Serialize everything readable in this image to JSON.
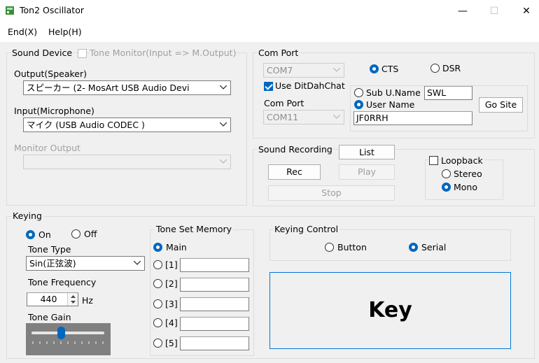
{
  "window": {
    "title": "Ton2 Oscillator",
    "minimize": "—",
    "maximize": "☐",
    "close": "✕"
  },
  "menu": {
    "end": "End(X)",
    "help": "Help(H)"
  },
  "sound_device": {
    "legend": "Sound Device",
    "tone_monitor_label": "Tone Monitor(Input => M.Output)",
    "tone_monitor_checked": false,
    "output_label": "Output(Speaker)",
    "output_value": "スピーカー (2- MosArt USB Audio Devi",
    "input_label": "Input(Microphone)",
    "input_value": "マイク (USB Audio CODEC )",
    "monitor_label": "Monitor Output",
    "monitor_value": ""
  },
  "com_port": {
    "legend": "Com Port",
    "port_value": "COM7",
    "cts_label": "CTS",
    "dsr_label": "DSR",
    "selected_signal": "CTS",
    "ditdah_label": "Use DitDahChat",
    "ditdah_checked": true,
    "sub_port_label": "Com Port",
    "sub_port_value": "COM11",
    "sub_uname_label": "Sub U.Name",
    "sub_uname_value": "SWL",
    "user_name_label": "User Name",
    "user_name_value": "JF0RRH",
    "selected_name": "User Name",
    "go_site_label": "Go Site"
  },
  "sound_recording": {
    "legend": "Sound Recording",
    "list_label": "List",
    "rec_label": "Rec",
    "play_label": "Play",
    "stop_label": "Stop",
    "loopback_label": "Loopback",
    "loopback_checked": false,
    "stereo_label": "Stereo",
    "mono_label": "Mono",
    "selected_channel": "Mono"
  },
  "keying": {
    "legend": "Keying",
    "on_label": "On",
    "off_label": "Off",
    "selected": "On",
    "tone_type_label": "Tone Type",
    "tone_type_value": "Sin(正弦波)",
    "tone_freq_label": "Tone Frequency",
    "tone_freq_value": "440",
    "tone_freq_unit": "Hz",
    "tone_gain_label": "Tone Gain",
    "tone_gain_level": 0.41
  },
  "tone_set_memory": {
    "legend": "Tone Set Memory",
    "selected": "Main",
    "items": [
      {
        "label": "Main"
      },
      {
        "label": "[1]",
        "value": ""
      },
      {
        "label": "[2]",
        "value": ""
      },
      {
        "label": "[3]",
        "value": ""
      },
      {
        "label": "[4]",
        "value": ""
      },
      {
        "label": "[5]",
        "value": ""
      }
    ]
  },
  "keying_control": {
    "legend": "Keying Control",
    "button_label": "Button",
    "serial_label": "Serial",
    "selected": "Serial",
    "key_label": "Key"
  },
  "colors": {
    "accent": "#0067c0",
    "key_border": "#0078d7",
    "background": "#f0f0f0"
  }
}
